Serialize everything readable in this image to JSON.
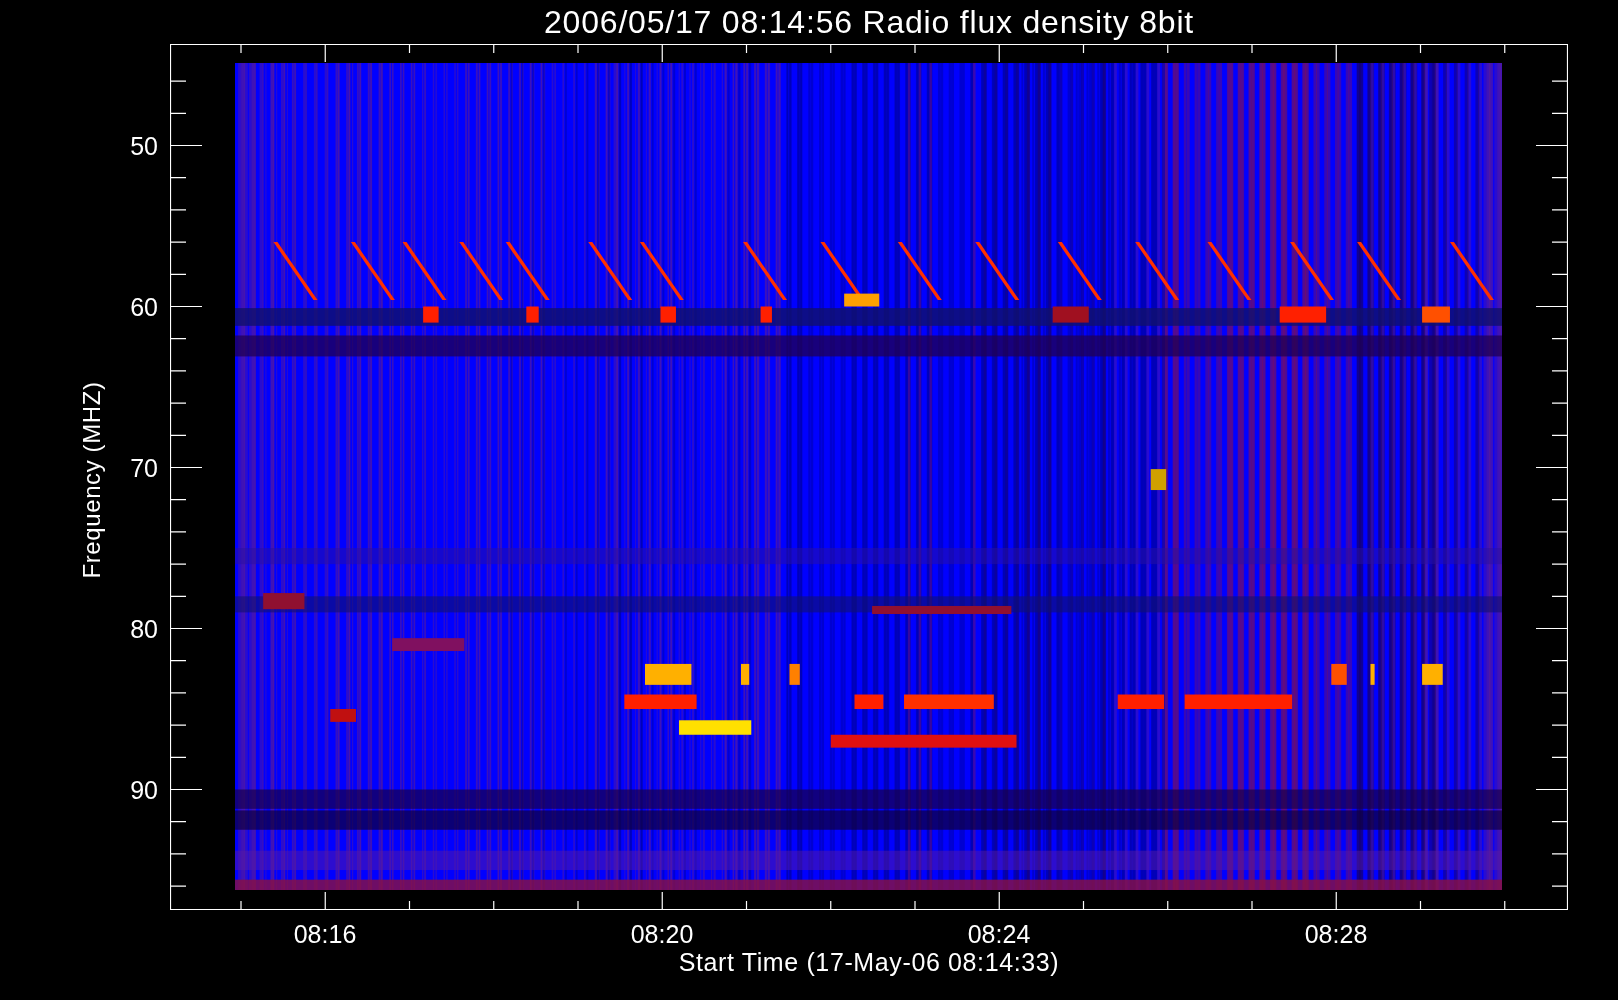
{
  "title": "2006/05/17 08:14:56 Radio flux density 8bit",
  "y_axis": {
    "label": "Frequency (MHZ)",
    "ticks": [
      "50",
      "60",
      "70",
      "80",
      "90"
    ]
  },
  "x_axis": {
    "label": "Start Time (17-May-06 08:14:33)",
    "ticks": [
      "08:16",
      "08:20",
      "08:24",
      "08:28"
    ]
  }
}
